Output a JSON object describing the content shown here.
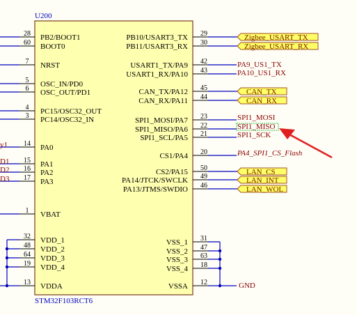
{
  "component": {
    "designator": "U200",
    "part": "STM32F103RCT6"
  },
  "colors": {
    "background": "#fefef6",
    "body_fill": "#ffffb0",
    "body_stroke": "#7a3a1a",
    "wire": "#0000c0",
    "pin_line": "#000000",
    "designator_text": "#0000c0",
    "net_text": "#8a0000",
    "port_fill": "#ffff66",
    "port_stroke": "#a05020",
    "port_text": "#7a2000",
    "arrow": "#e02020",
    "highlight": "#00aa00"
  },
  "left_pins": [
    {
      "num": "28",
      "name": "PB2/BOOT1"
    },
    {
      "num": "60",
      "name": "BOOT0"
    },
    {
      "num": "7",
      "name": "NRST"
    },
    {
      "num": "5",
      "name": "OSC_IN/PD0"
    },
    {
      "num": "6",
      "name": "OSC_OUT/PD1"
    },
    {
      "num": "4",
      "name": "PC15/OSC32_OUT"
    },
    {
      "num": "3",
      "name": "PC14/OSC32_IN"
    },
    {
      "num": "14",
      "name": "PA0"
    },
    {
      "num": "15",
      "name": "PA1"
    },
    {
      "num": "16",
      "name": "PA2"
    },
    {
      "num": "17",
      "name": "PA3"
    },
    {
      "num": "1",
      "name": "VBAT"
    },
    {
      "num": "32",
      "name": "VDD_1"
    },
    {
      "num": "48",
      "name": "VDD_2"
    },
    {
      "num": "64",
      "name": "VDD_3"
    },
    {
      "num": "19",
      "name": "VDD_4"
    },
    {
      "num": "13",
      "name": "VDDA"
    }
  ],
  "right_pins": [
    {
      "num": "29",
      "name": "PB10/USART3_TX"
    },
    {
      "num": "30",
      "name": "PB11/USART3_RX"
    },
    {
      "num": "42",
      "name": "USART1_TX/PA9"
    },
    {
      "num": "43",
      "name": "USART1_RX/PA10"
    },
    {
      "num": "45",
      "name": "CAN_TX/PA12"
    },
    {
      "num": "44",
      "name": "CAN_RX/PA11"
    },
    {
      "num": "23",
      "name": "SPI1_MOSI/PA7"
    },
    {
      "num": "22",
      "name": "SPI1_MISO/PA6"
    },
    {
      "num": "21",
      "name": "SPI1_SCL/PA5"
    },
    {
      "num": "20",
      "name": "CS1/PA4"
    },
    {
      "num": "50",
      "name": "CS2/PA15"
    },
    {
      "num": "49",
      "name": "PA14/JTCK/SWCLK"
    },
    {
      "num": "46",
      "name": "PA13/JTMS/SWDIO"
    },
    {
      "num": "31",
      "name": "VSS_1"
    },
    {
      "num": "47",
      "name": "VSS_2"
    },
    {
      "num": "63",
      "name": "VSS_3"
    },
    {
      "num": "18",
      "name": "VSS_4"
    },
    {
      "num": "12",
      "name": "VSSA"
    }
  ],
  "ports": {
    "zigbee_tx": "Zigbee_USART_TX",
    "zigbee_rx": "Zigbee_USART_RX",
    "can_tx": "CAN_TX",
    "can_rx": "CAN_RX",
    "lan_cs": "LAN_CS",
    "lan_int": "LAN_INT",
    "lan_wol": "LAN_WOL"
  },
  "nets": {
    "pa9": "PA9_US1_TX",
    "pa10": "PA10_US1_RX",
    "mosi": "SPI1_MOSI",
    "miso": "SPI1_MISO",
    "sck": "SPI1_SCK",
    "cs_flash": "PA4_SPI1_CS_Flash",
    "gnd": "GND",
    "left_pa0": "y1",
    "left_pa1": "D1",
    "left_pa2": "D2",
    "left_pa3": "D3"
  }
}
